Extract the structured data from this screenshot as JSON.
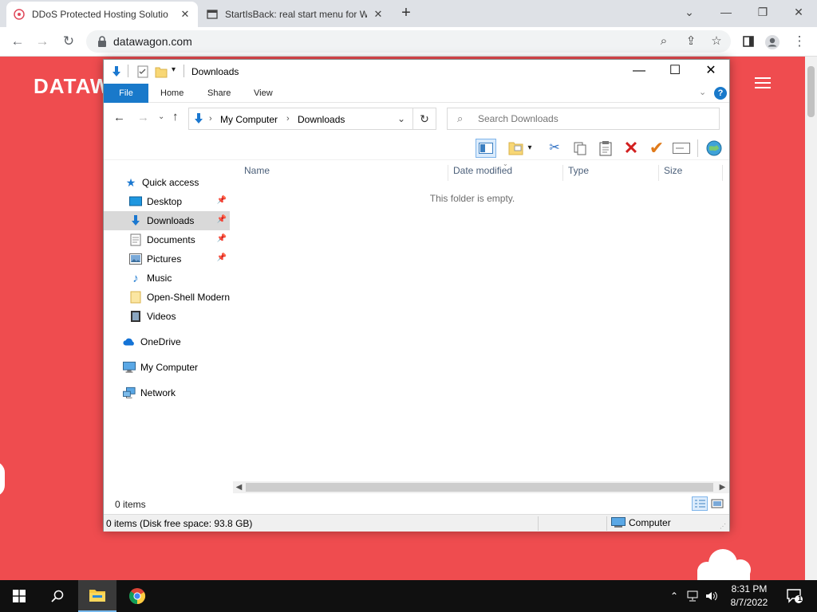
{
  "browser": {
    "tabs": [
      {
        "title": "DDoS Protected Hosting Solutio",
        "active": true
      },
      {
        "title": "StartIsBack: real start menu for W",
        "active": false
      }
    ],
    "url": "datawagon.com"
  },
  "website": {
    "logo_text": "DATAW",
    "background_color": "#ef4c4f"
  },
  "explorer": {
    "title": "Downloads",
    "ribbon_tabs": [
      "File",
      "Home",
      "Share",
      "View"
    ],
    "breadcrumb": [
      "My Computer",
      "Downloads"
    ],
    "search_placeholder": "Search Downloads",
    "columns": [
      "Name",
      "Date modified",
      "Type",
      "Size"
    ],
    "empty_message": "This folder is empty.",
    "nav": {
      "quick_access": "Quick access",
      "items": [
        {
          "label": "Desktop",
          "icon": "desktop-icon",
          "pinned": true
        },
        {
          "label": "Downloads",
          "icon": "downloads-icon",
          "pinned": true,
          "selected": true
        },
        {
          "label": "Documents",
          "icon": "documents-icon",
          "pinned": true
        },
        {
          "label": "Pictures",
          "icon": "pictures-icon",
          "pinned": true
        },
        {
          "label": "Music",
          "icon": "music-icon",
          "pinned": false
        },
        {
          "label": "Open-Shell Modern",
          "icon": "folder-icon",
          "pinned": false
        },
        {
          "label": "Videos",
          "icon": "videos-icon",
          "pinned": false
        }
      ],
      "onedrive": "OneDrive",
      "my_computer": "My Computer",
      "network": "Network"
    },
    "item_count": "0 items",
    "status_info": "0 items (Disk free space: 93.8 GB)",
    "status_zone": "Computer"
  },
  "taskbar": {
    "time": "8:31 PM",
    "date": "8/7/2022",
    "notification_count": "1"
  }
}
